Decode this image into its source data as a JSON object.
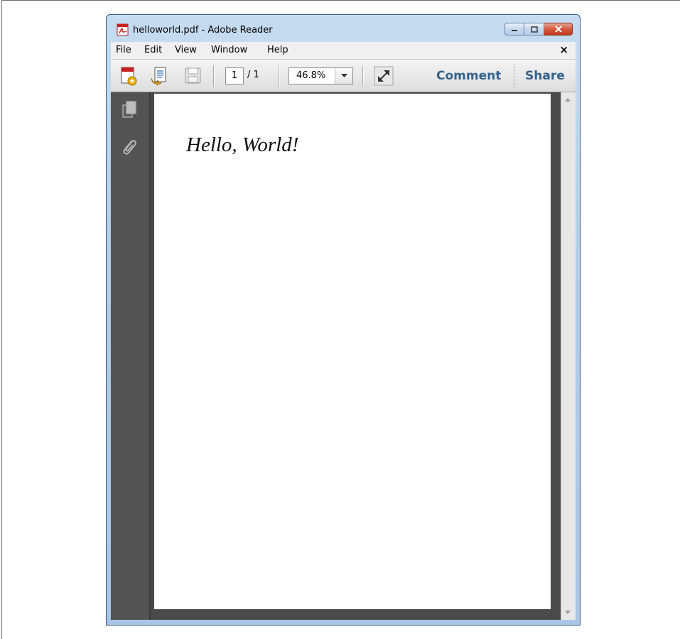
{
  "window": {
    "title": "helloworld.pdf - Adobe Reader",
    "app_icon": "adobe-pdf-icon"
  },
  "menu": {
    "items": [
      "File",
      "Edit",
      "View",
      "Window",
      "Help"
    ],
    "close_glyph": "×"
  },
  "toolbar": {
    "icons": [
      "create-pdf-icon",
      "print-icon",
      "save-icon",
      "full-screen-icon"
    ],
    "current_page": "1",
    "total_pages": "/ 1",
    "zoom": "46.8%",
    "comment_label": "Comment",
    "share_label": "Share"
  },
  "sidebar": {
    "icons": [
      "pages-icon",
      "attachments-icon"
    ]
  },
  "document": {
    "text": "Hello, World!"
  },
  "colors": {
    "link": "#34628c",
    "sidebar": "#535353",
    "close_button": "#d45a40"
  }
}
